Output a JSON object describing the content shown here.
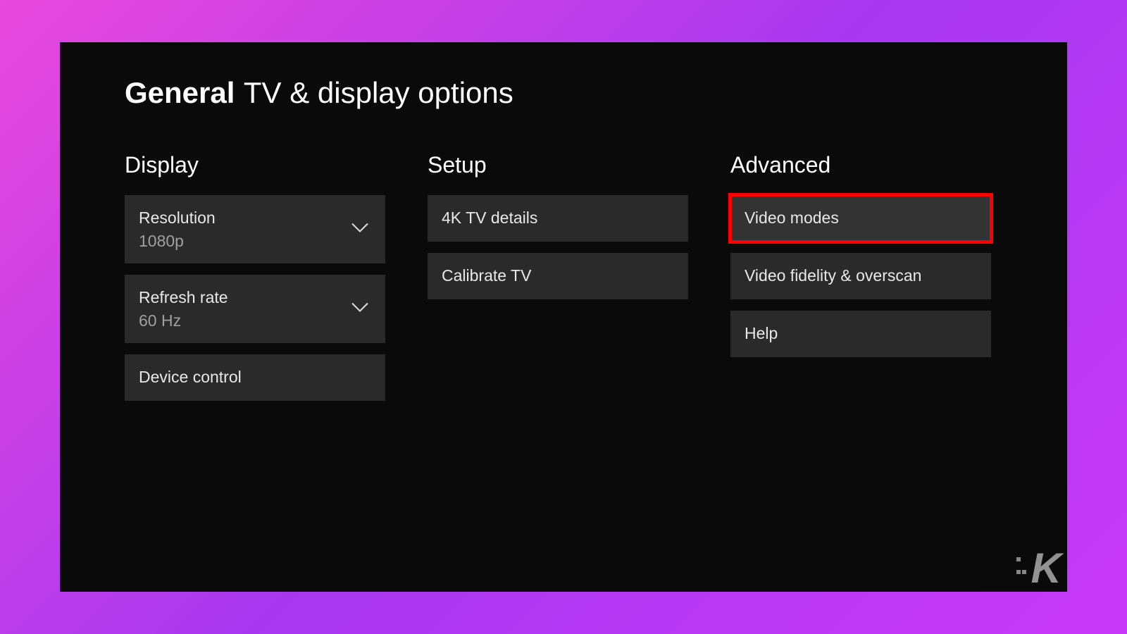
{
  "title": {
    "bold": "General",
    "rest": "TV & display options"
  },
  "columns": {
    "display": {
      "header": "Display",
      "resolution": {
        "label": "Resolution",
        "value": "1080p"
      },
      "refresh": {
        "label": "Refresh rate",
        "value": "60 Hz"
      },
      "device_control": {
        "label": "Device control"
      }
    },
    "setup": {
      "header": "Setup",
      "detail_4k": {
        "label": "4K TV details"
      },
      "calibrate": {
        "label": "Calibrate TV"
      }
    },
    "advanced": {
      "header": "Advanced",
      "video_modes": {
        "label": "Video modes"
      },
      "fidelity": {
        "label": "Video fidelity & overscan"
      },
      "help": {
        "label": "Help"
      }
    }
  },
  "watermark": "K"
}
